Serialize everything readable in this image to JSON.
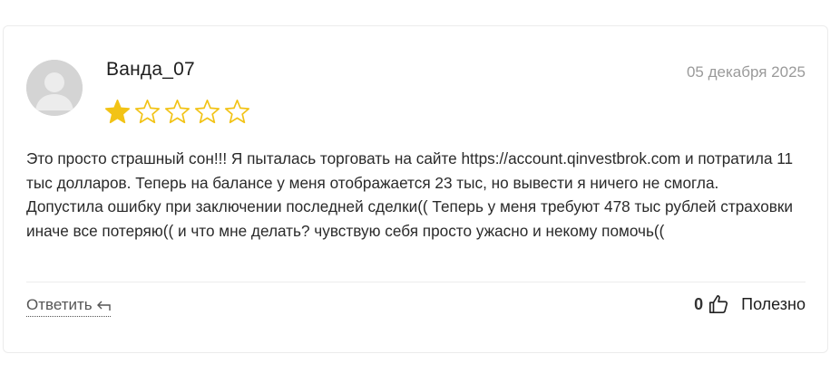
{
  "review": {
    "author": "Ванда_07",
    "date": "05 декабря 2025",
    "rating": 1,
    "rating_max": 5,
    "star_color": "#f2c316",
    "text": "Это просто страшный сон!!! Я пыталась торговать на сайте https://account.qinvestbrok.com и потратила 11 тыс долларов. Теперь на балансе у меня отображается 23 тыс, но вывести я ничего не смогла. Допустила ошибку при заключении последней сделки(( Теперь у меня требуют 478 тыс рублей страховки иначе все потеряю(( и что мне делать? чувствую себя просто ужасно и некому помочь(("
  },
  "actions": {
    "reply_label": "Ответить",
    "reply_icon": "reply-arrow-icon",
    "helpful_count": "0",
    "helpful_icon": "thumbs-up-icon",
    "helpful_label": "Полезно"
  }
}
